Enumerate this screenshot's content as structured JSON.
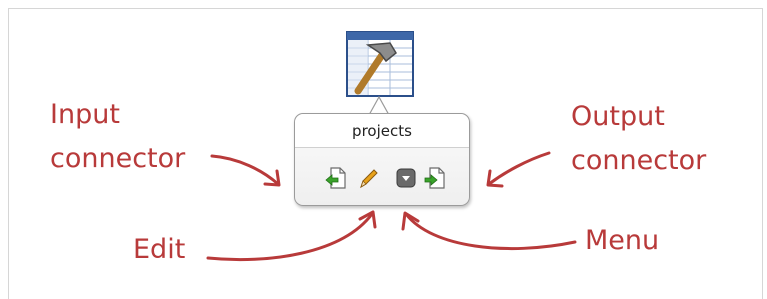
{
  "node": {
    "title": "projects",
    "icon": "spreadsheet-tools-icon",
    "toolbar": [
      {
        "name": "input-connector",
        "icon": "page-arrow-left-icon"
      },
      {
        "name": "edit",
        "icon": "pencil-icon"
      },
      {
        "name": "menu",
        "icon": "dropdown-menu-icon"
      },
      {
        "name": "output-connector",
        "icon": "page-arrow-right-icon"
      }
    ]
  },
  "callouts": {
    "input_line1": "Input",
    "input_line2": "connector",
    "output_line1": "Output",
    "output_line2": "connector",
    "edit": "Edit",
    "menu": "Menu"
  },
  "colors": {
    "annotation": "#b83a3a",
    "arrow_green": "#3aa22b",
    "pencil": "#e8a21a"
  }
}
